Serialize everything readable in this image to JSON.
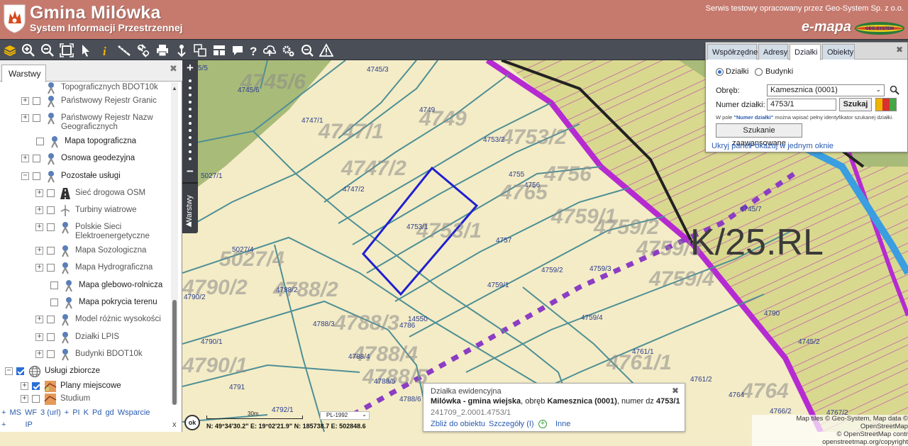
{
  "header": {
    "title": "Gmina Milówka",
    "subtitle": "System Informacji Przestrzennej",
    "provider_note": "Serwis testowy opracowany przez Geo-System Sp. z o.o.",
    "brand": "e-mapa",
    "badge_text": "GEO-SYSTEM"
  },
  "toolbar": {
    "tools": [
      "layers-icon",
      "zoom-in-icon",
      "zoom-out-icon",
      "zoom-extent-icon",
      "pointer-icon",
      "info-icon",
      "measure-distance-icon",
      "link-icon",
      "print-icon",
      "pin-icon",
      "select-area-icon",
      "panel-layout-icon",
      "comment-icon",
      "help-icon",
      "cloud-upload-icon",
      "settings-icon",
      "search-map-icon",
      "warning-icon"
    ]
  },
  "layers": {
    "tab_label": "Warstwy",
    "items": [
      {
        "label": "Topograficznych BDOT10k",
        "dark": false
      },
      {
        "label": "Państwowy Rejestr Granic",
        "dark": false
      },
      {
        "label": "Państwowy Rejestr Nazw Geograficznych",
        "dark": false
      },
      {
        "label": "Mapa topograficzna",
        "dark": true
      },
      {
        "label": "Osnowa geodezyjna",
        "dark": true
      },
      {
        "label": "Pozostałe usługi",
        "dark": true
      },
      {
        "label": "Sieć drogowa OSM",
        "dark": false
      },
      {
        "label": "Turbiny wiatrowe",
        "dark": false
      },
      {
        "label": "Polskie Sieci Elektroenergetyczne",
        "dark": false
      },
      {
        "label": "Mapa Sozologiczna",
        "dark": false
      },
      {
        "label": "Mapa Hydrograficzna",
        "dark": false
      },
      {
        "label": "Mapa glebowo-rolnicza",
        "dark": true
      },
      {
        "label": "Mapa pokrycia terenu",
        "dark": true
      },
      {
        "label": "Model różnic wysokości",
        "dark": false
      },
      {
        "label": "Działki LPIS",
        "dark": false
      },
      {
        "label": "Budynki BDOT10k",
        "dark": false
      },
      {
        "label": "Usługi zbiorcze",
        "dark": true
      },
      {
        "label": "Plany miejscowe",
        "dark": true
      },
      {
        "label": "Studium",
        "dark": false
      }
    ],
    "footer_line1": [
      "+",
      "MS",
      "WF",
      "3 (url)",
      "+",
      "PI",
      "K",
      "Pd",
      "gd",
      "Wsparcie"
    ],
    "footer_line2": [
      "+",
      "IP"
    ],
    "collapse_label": "x"
  },
  "map": {
    "zoom_in": "+",
    "zoom_out": "−",
    "side_tab": "Warstwy",
    "zone_label": "K/25.RL",
    "highlighted_parcel": "4753/1",
    "parcel_labels": [
      "5/5",
      "4745/3",
      "4745/6",
      "4749",
      "4747/1",
      "4753/2",
      "4747/2",
      "5027/1",
      "4755",
      "4756",
      "4753/1",
      "4757",
      "4759/2",
      "4759/3",
      "4745/7",
      "5027/4",
      "4759/1",
      "4788/2",
      "4790/2",
      "4788/3",
      "14550",
      "4786",
      "4759/4",
      "4790/1",
      "4788/4",
      "4788/5",
      "4761/1",
      "4791",
      "4788/6",
      "4761/2",
      "4764",
      "4792/1",
      "4766/2",
      "4767/2",
      "4790",
      "4745/2"
    ],
    "big_labels": [
      "4745/6",
      "4749",
      "4747/1",
      "4753/2",
      "4747/2",
      "4765",
      "4756",
      "4753/1",
      "4759/1",
      "4759/2",
      "4759/3",
      "5027/4",
      "4788/2",
      "4790/2",
      "4788/3",
      "4759/4",
      "4790/1",
      "4788/4",
      "4788/5",
      "4761/1",
      "4764"
    ]
  },
  "search": {
    "tabs": [
      "Współrzędne",
      "Adresy",
      "Działki",
      "Obiekty"
    ],
    "active_tab": "Działki",
    "radio_parcels": "Działki",
    "radio_buildings": "Budynki",
    "precinct_label": "Obręb:",
    "precinct_value": "Kamesznica (0001)",
    "number_label": "Numer działki:",
    "number_value": "4753/1",
    "search_button": "Szukaj",
    "hint_prefix": "W pole ",
    "hint_field": "\"Numer działki\"",
    "hint_suffix": " można wpisać pełny identyfikator szukanej działki.",
    "advanced_button": "Szukanie zaawansowane",
    "hide_panel": "Ukryj panel",
    "show_one_window": "Pokazuj w jednym oknie"
  },
  "info_popup": {
    "heading": "Działka ewidencyjna",
    "municipality": "Milówka - gmina wiejska",
    "precinct_text": ", obręb ",
    "precinct": "Kamesznica (0001)",
    "number_text": ", numer dz ",
    "number": "4753/1",
    "identifier": "241709_2.0001.4753/1",
    "zoom_link": "Zbliż do obiektu",
    "details_link": "Szczegóły (I)",
    "more_link": "Inne"
  },
  "status": {
    "ok": "ok",
    "scale": "30m",
    "crs": "PL-1992",
    "coords": "N: 49°34'30.2\"   E: 19°02'21.9\"   N: 185738.7   E: 502848.6",
    "attribution_line1": "Map tiles © Geo-System, Map data © OpenStreetMap",
    "attribution_line2": "© OpenStreetMap contr   openstreetmap.org/copyright"
  },
  "colors": {
    "header_bg": "#c67a6e",
    "toolbar_bg": "#4a4e56",
    "parcel_fill": "#f4ecc6",
    "forest_fill": "#b9c483",
    "plan_zone_stroke": "#b52bd1",
    "parcel_line": "#4e8f96",
    "highlight": "#2020d0",
    "water": "#3a9ee0"
  }
}
